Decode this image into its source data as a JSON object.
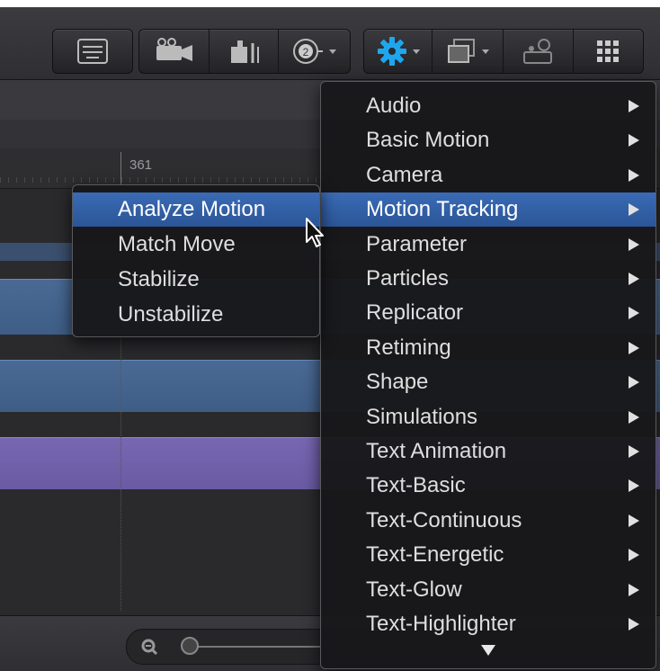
{
  "toolbar": {
    "buttons": [
      {
        "icon": "layout-icon"
      },
      {
        "icon": "camera-icon"
      },
      {
        "icon": "light-icon"
      },
      {
        "icon": "target-2-icon"
      },
      {
        "icon": "gear-icon"
      },
      {
        "icon": "filter-icon"
      },
      {
        "icon": "generator-icon"
      },
      {
        "icon": "grid-dots-icon"
      }
    ]
  },
  "timeline": {
    "ruler_value": "361"
  },
  "behaviors_menu": {
    "items": [
      {
        "label": "Audio"
      },
      {
        "label": "Basic Motion"
      },
      {
        "label": "Camera"
      },
      {
        "label": "Motion Tracking",
        "selected": true
      },
      {
        "label": "Parameter"
      },
      {
        "label": "Particles"
      },
      {
        "label": "Replicator"
      },
      {
        "label": "Retiming"
      },
      {
        "label": "Shape"
      },
      {
        "label": "Simulations"
      },
      {
        "label": "Text Animation"
      },
      {
        "label": "Text-Basic"
      },
      {
        "label": "Text-Continuous"
      },
      {
        "label": "Text-Energetic"
      },
      {
        "label": "Text-Glow"
      },
      {
        "label": "Text-Highlighter"
      }
    ]
  },
  "motion_tracking_submenu": {
    "items": [
      {
        "label": "Analyze Motion",
        "selected": true
      },
      {
        "label": "Match Move"
      },
      {
        "label": "Stabilize"
      },
      {
        "label": "Unstabilize"
      }
    ]
  },
  "colors": {
    "selection": "#2f5fa8",
    "gear_icon": "#1ea6ee",
    "blue_track": "#44638c",
    "purple_track": "#6f5fa9"
  }
}
